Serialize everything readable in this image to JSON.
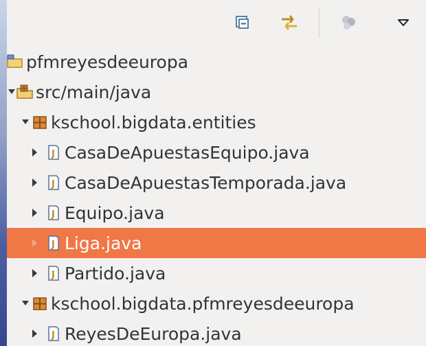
{
  "toolbar": {
    "buttons": [
      {
        "icon": "collapse-all-icon"
      },
      {
        "icon": "link-with-editor-icon"
      },
      {
        "icon": "focus-task-icon"
      },
      {
        "icon": "view-menu-chevron-icon"
      }
    ]
  },
  "tree": {
    "items": [
      {
        "label": "pfmreyesdeeuropa",
        "icon": "project-icon",
        "depth": 0
      },
      {
        "label": "src/main/java",
        "icon": "source-folder-icon",
        "depth": 1,
        "expanded": true
      },
      {
        "label": "kschool.bigdata.entities",
        "icon": "package-icon",
        "depth": 2,
        "expanded": true
      },
      {
        "label": "CasaDeApuestasEquipo.java",
        "icon": "java-file-icon",
        "depth": 3
      },
      {
        "label": "CasaDeApuestasTemporada.java",
        "icon": "java-file-icon",
        "depth": 3
      },
      {
        "label": "Equipo.java",
        "icon": "java-file-icon",
        "depth": 3
      },
      {
        "label": "Liga.java",
        "icon": "java-file-icon",
        "depth": 3,
        "selected": true
      },
      {
        "label": "Partido.java",
        "icon": "java-file-icon",
        "depth": 3
      },
      {
        "label": "kschool.bigdata.pfmreyesdeeuropa",
        "icon": "package-icon",
        "depth": 2,
        "expanded": true
      },
      {
        "label": "ReyesDeEuropa.java",
        "icon": "java-file-icon",
        "depth": 3
      }
    ]
  },
  "colors": {
    "panel_background": "#f2f1f0",
    "selection": "#f07746",
    "text": "#2f3437"
  }
}
